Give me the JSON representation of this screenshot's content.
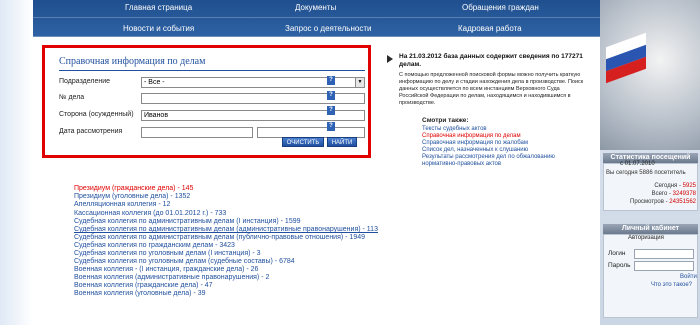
{
  "nav": {
    "top_row": [
      "Главная страница",
      "Документы",
      "Обращения граждан"
    ],
    "bottom_row": [
      "Новости и события",
      "Запрос о деятельности",
      "Кадровая работа"
    ]
  },
  "form": {
    "title": "Справочная информация по делам",
    "division_label": "Подразделение",
    "division_value": "- Все -",
    "case_no_label": "№ дела",
    "case_no_value": "",
    "party_label": "Сторона (осужденный)",
    "party_value": "Иванов",
    "date_label": "Дата рассмотрения",
    "date_from": "",
    "date_to": "",
    "help_glyph": "?",
    "clear_button": "ОЧИСТИТЬ",
    "find_button": "НАЙТИ"
  },
  "info": {
    "headline": "На 21.03.2012 база данных содержит сведения по 177271 делам.",
    "text": "С помощью предложенной поисковой формы можно получить краткую информацию по делу и стадии нахождения дела в производстве. Поиск данных осуществляется по всем инстанциям Верховного Суда Российской Федерации по делам, находящимся и находившимся в производстве.",
    "see_also": "Смотри также:",
    "links": [
      "Тексты судебных актов",
      "Справочная информация по делам",
      "Справочная информация по жалобам",
      "Список дел, назначенных к слушанию",
      "Результаты рассмотрения дел по обжалованию",
      "нормативно-правовых актов"
    ]
  },
  "results": [
    "Президиум (гражданские дела) - 145",
    "Президиум (уголовные дела) - 1352",
    "Апелляционная коллегия - 12",
    "Кассационная коллегия (до 01.01.2012 г.) - 733",
    "Судебная коллегия по административным делам (I инстанция) - 1599",
    "Судебная коллегия по административным делам (административные правонарушения) - 113",
    "Судебная коллегия по административным делам (публично-правовые отношения) - 1949",
    "Судебная коллегия по гражданским делам - 3423",
    "Судебная коллегия по уголовным делам (I инстанция) - 3",
    "Судебная коллегия по уголовным делам (судебные составы) - 6784",
    "Военная коллегия - (I инстанция, гражданские дела) - 26",
    "Военная коллегия (административные правонарушения) - 2",
    "Военная коллегия (гражданские дела) - 47",
    "Военная коллегия (уголовные дела) - 39"
  ],
  "stats": {
    "title": "Статистика посещений",
    "since": "с 01.07.2010",
    "today_visitors": "Вы сегодня 5886 посетитель",
    "today_label": "Сегодня - ",
    "today_value": "5925",
    "total_label": "Всего - ",
    "total_value": "3249378",
    "views_label": "Просмотров - ",
    "views_value": "24351562"
  },
  "cabinet": {
    "title": "Личный кабинет",
    "subtitle": "Авторизация",
    "login_label": "Логин",
    "password_label": "Пароль",
    "enter_link": "Войти",
    "what_link": "Что это такое?"
  },
  "colors": {
    "nav": "#2e62a4",
    "link": "#1f4f9e",
    "highlight": "#e00000"
  }
}
